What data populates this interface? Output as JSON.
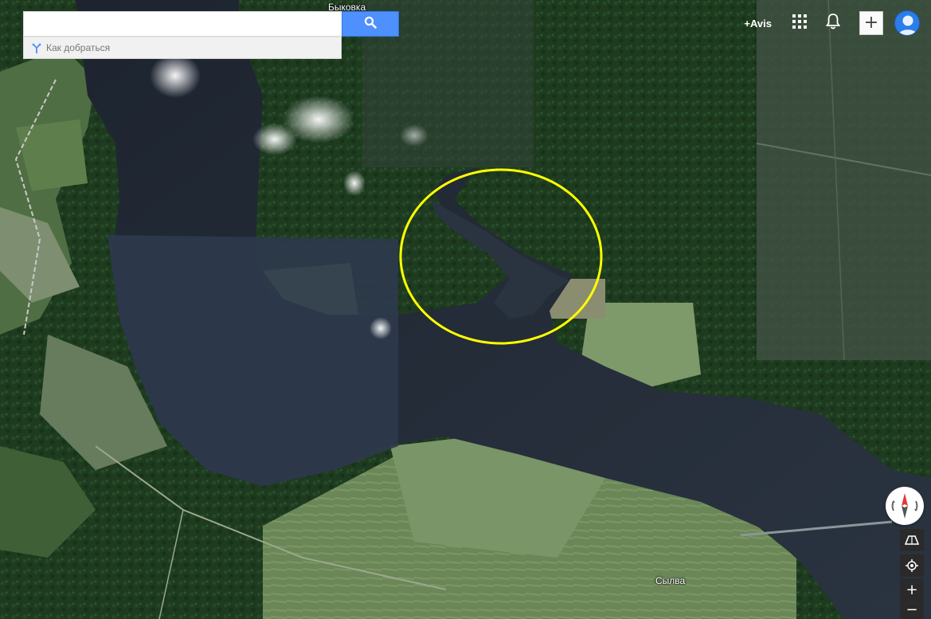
{
  "search": {
    "placeholder": "",
    "value": "",
    "button_icon": "search-icon",
    "directions_label": "Как добраться",
    "directions_icon": "directions-icon"
  },
  "topbar": {
    "plus_user": "+Avis",
    "apps_icon": "apps-grid-icon",
    "notifications_icon": "bell-icon",
    "share_icon": "plus-icon",
    "avatar_icon": "profile-avatar-icon"
  },
  "map": {
    "type": "satellite",
    "place_labels": {
      "top": "Быковка",
      "bottom": "Сылва"
    },
    "annotation": {
      "shape": "circle",
      "color": "#ffff00"
    },
    "colors": {
      "water": "#28323d",
      "forest": "#1c3a1f",
      "field": "#6f8a5a"
    }
  },
  "controls": {
    "compass_icon": "compass-icon",
    "tilt_icon": "tilt-icon",
    "location_icon": "my-location-icon",
    "zoom_in": "+",
    "zoom_out": "−"
  }
}
